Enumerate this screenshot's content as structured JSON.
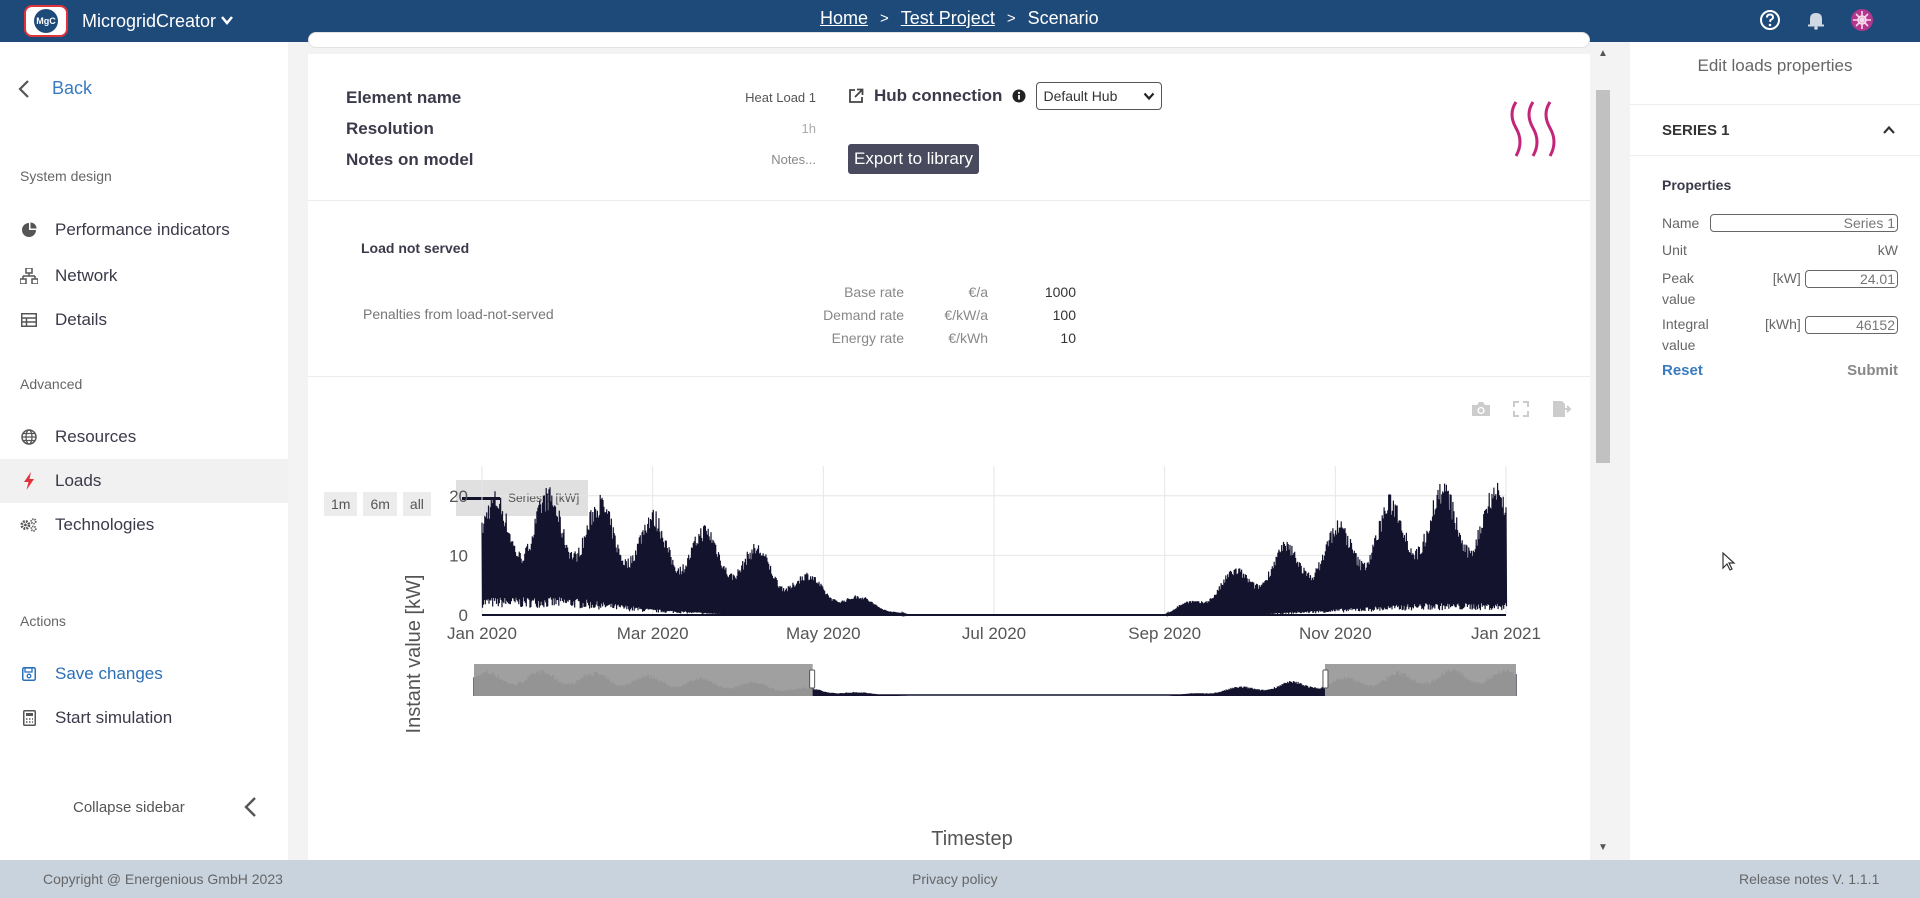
{
  "topbar": {
    "logo_text": "MgC",
    "app_name": "MicrogridCreator",
    "breadcrumb": [
      "Home",
      "Test Project",
      "Scenario"
    ],
    "icons": [
      "help-icon",
      "bell-icon",
      "user-avatar-icon"
    ]
  },
  "sidebar": {
    "back_label": "Back",
    "sections": {
      "system_design": "System design",
      "advanced": "Advanced",
      "actions": "Actions"
    },
    "items": {
      "performance": "Performance indicators",
      "network": "Network",
      "details": "Details",
      "resources": "Resources",
      "loads": "Loads",
      "technologies": "Technologies",
      "save": "Save changes",
      "simulate": "Start simulation"
    },
    "collapse_label": "Collapse sidebar"
  },
  "element": {
    "name_label": "Element name",
    "name_value": "Heat Load 1",
    "resolution_label": "Resolution",
    "resolution_value": "1h",
    "notes_label": "Notes on model",
    "notes_placeholder": "Notes...",
    "hub_label": "Hub connection",
    "hub_value": "Default Hub",
    "export_label": "Export to library"
  },
  "load_not_served": {
    "title": "Load not served",
    "description": "Penalties from load-not-served",
    "rates": [
      {
        "label": "Base rate",
        "unit": "€/a",
        "value": "1000"
      },
      {
        "label": "Demand rate",
        "unit": "€/kW/a",
        "value": "100"
      },
      {
        "label": "Energy rate",
        "unit": "€/kWh",
        "value": "10"
      }
    ]
  },
  "chart_controls": {
    "range_buttons": [
      "1m",
      "6m",
      "all"
    ]
  },
  "chart_data": {
    "type": "area",
    "ylabel": "Instant value [kW]",
    "xlabel": "Timestep",
    "ylim": [
      0,
      25
    ],
    "yticks": [
      0,
      10,
      20
    ],
    "xticks": [
      "Jan 2020",
      "Mar 2020",
      "May 2020",
      "Jul 2020",
      "Sep 2020",
      "Nov 2020",
      "Jan 2021"
    ],
    "series": [
      {
        "name": "Series 1 [kW]",
        "color": "#14132e",
        "profile": [
          {
            "month": "Jan 2020",
            "min": 3,
            "max": 21
          },
          {
            "month": "Feb 2020",
            "min": 3,
            "max": 22
          },
          {
            "month": "Mar 2020",
            "min": 1,
            "max": 18
          },
          {
            "month": "Apr 2020",
            "min": 0,
            "max": 14
          },
          {
            "month": "May 2020",
            "min": 0,
            "max": 6
          },
          {
            "month": "Jun 2020",
            "min": 0,
            "max": 0
          },
          {
            "month": "Jul 2020",
            "min": 0,
            "max": 0
          },
          {
            "month": "Aug 2020",
            "min": 0,
            "max": 0
          },
          {
            "month": "Sep 2020",
            "min": 0,
            "max": 0
          },
          {
            "month": "Oct 2020",
            "min": 0,
            "max": 10
          },
          {
            "month": "Nov 2020",
            "min": 1,
            "max": 16
          },
          {
            "month": "Dec 2020",
            "min": 2,
            "max": 23
          }
        ]
      }
    ],
    "grid": true,
    "legend_position": "top-left",
    "range_selector": {
      "from": "Apr 2020",
      "to": "Oct 2020"
    }
  },
  "right_panel": {
    "title": "Edit loads properties",
    "series_title": "SERIES 1",
    "properties_title": "Properties",
    "name_label": "Name",
    "name_value": "Series 1",
    "unit_label": "Unit",
    "unit_value": "kW",
    "peak_label": "Peak value",
    "peak_unit": "[kW]",
    "peak_value": "24.01",
    "integral_label": "Integral value",
    "integral_unit": "[kWh]",
    "integral_value": "46152",
    "reset_label": "Reset",
    "submit_label": "Submit"
  },
  "footer": {
    "copyright": "Copyright @ Energenious GmbH 2023",
    "privacy": "Privacy policy",
    "release": "Release notes V. 1.1.1"
  },
  "colors": {
    "topbar": "#1e4a7a",
    "accent_blue": "#2a6fb8",
    "series": "#14132e",
    "heat_icon": "#c2257a",
    "logo_border": "#e0323a"
  }
}
